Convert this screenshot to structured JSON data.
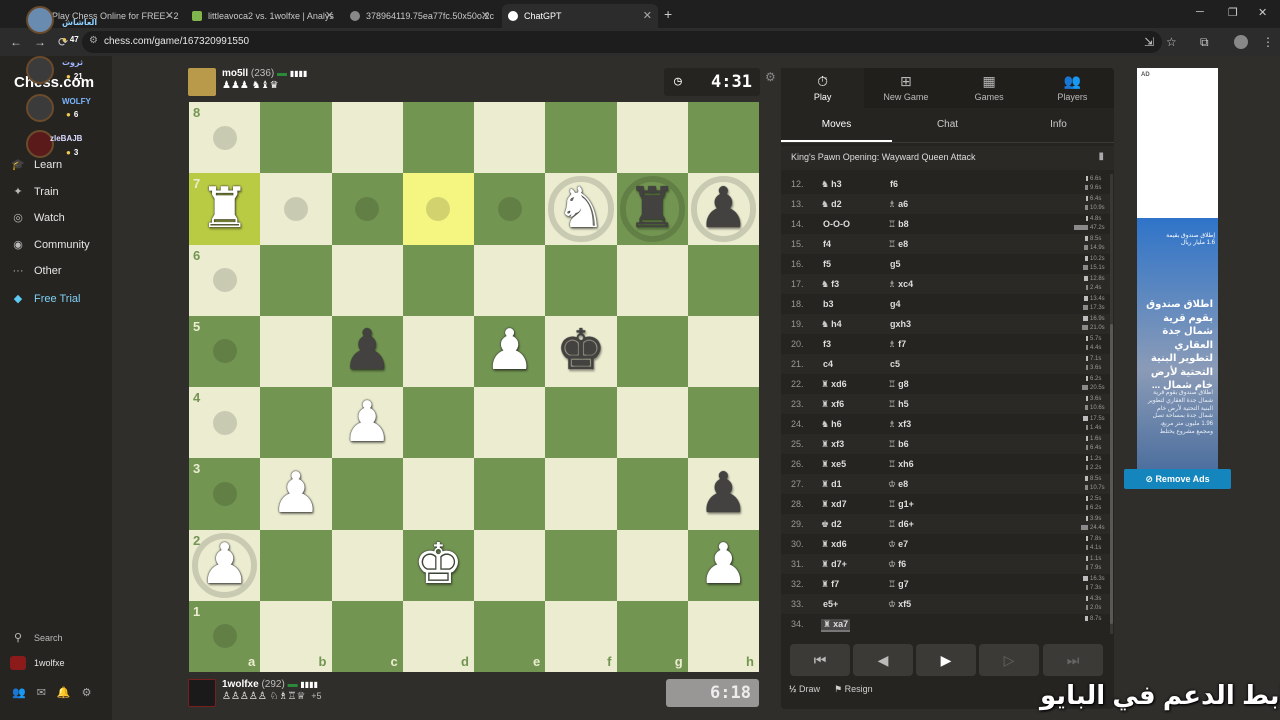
{
  "browser": {
    "tabs": [
      {
        "title": "Play Chess Online for FREE - 2 P",
        "active": false
      },
      {
        "title": "littleavoca2 vs. 1wolfxe | Analys",
        "active": false
      },
      {
        "title": "378964119.75ea77fc.50x50o.2c",
        "active": false
      },
      {
        "title": "ChatGPT",
        "active": true
      }
    ],
    "url": "chess.com/game/167320991550"
  },
  "overlay_users": [
    {
      "name": "العاشاش",
      "coins": "47"
    },
    {
      "name": "ثروت",
      "coins": "21"
    },
    {
      "name": "WOLFY",
      "coins": "6"
    },
    {
      "name": "zleBAJB",
      "coins": "3"
    }
  ],
  "sidebar": {
    "logo": "Chess.com",
    "items": [
      {
        "label": "Learn",
        "icon": "graduation-icon"
      },
      {
        "label": "Train",
        "icon": "target-icon"
      },
      {
        "label": "Watch",
        "icon": "binoculars-icon"
      },
      {
        "label": "Community",
        "icon": "community-icon"
      },
      {
        "label": "Other",
        "icon": "more-icon"
      },
      {
        "label": "Free Trial",
        "icon": "diamond-icon"
      }
    ],
    "search": "Search",
    "user": "1wolfxe"
  },
  "top_player": {
    "name": "mo5ll",
    "rating": "(236)",
    "captured": "♟♟♟ ♞♝♛"
  },
  "bottom_player": {
    "name": "1wolfxe",
    "rating": "(292)",
    "captured": "♙♙♙♙♙ ♘♗♖♕",
    "advantage": "+5"
  },
  "clocks": {
    "top": "4:31",
    "bottom": "6:18"
  },
  "board": {
    "ranks": [
      "8",
      "7",
      "6",
      "5",
      "4",
      "3",
      "2",
      "1"
    ],
    "files": [
      "a",
      "b",
      "c",
      "d",
      "e",
      "f",
      "g",
      "h"
    ],
    "pieces": [
      {
        "sq": "a7",
        "glyph": "♜",
        "color": "w"
      },
      {
        "sq": "f7",
        "glyph": "♞",
        "color": "w"
      },
      {
        "sq": "g7",
        "glyph": "♜",
        "color": "b"
      },
      {
        "sq": "h7",
        "glyph": "♟",
        "color": "b"
      },
      {
        "sq": "c5",
        "glyph": "♟",
        "color": "b"
      },
      {
        "sq": "e5",
        "glyph": "♟",
        "color": "w"
      },
      {
        "sq": "f5",
        "glyph": "♚",
        "color": "b"
      },
      {
        "sq": "c4",
        "glyph": "♟",
        "color": "w"
      },
      {
        "sq": "b3",
        "glyph": "♟",
        "color": "w"
      },
      {
        "sq": "h3",
        "glyph": "♟",
        "color": "b"
      },
      {
        "sq": "a2",
        "glyph": "♟",
        "color": "w"
      },
      {
        "sq": "d2",
        "glyph": "♚",
        "color": "w"
      },
      {
        "sq": "h2",
        "glyph": "♟",
        "color": "w"
      }
    ],
    "highlight": [
      "a7",
      "d7"
    ],
    "dots": [
      "a8",
      "b7",
      "c7",
      "d7",
      "e7",
      "a6",
      "a5",
      "a4",
      "a3",
      "a1"
    ],
    "rings": [
      "f7",
      "g7",
      "h7",
      "a2"
    ]
  },
  "panel": {
    "tabs": [
      {
        "label": "Play",
        "icon": "stopwatch-icon"
      },
      {
        "label": "New Game",
        "icon": "plus-icon"
      },
      {
        "label": "Games",
        "icon": "board-icon"
      },
      {
        "label": "Players",
        "icon": "players-icon"
      }
    ],
    "subtabs": [
      "Moves",
      "Chat",
      "Info"
    ],
    "opening": "King's Pawn Opening: Wayward Queen Attack",
    "moves": [
      {
        "n": "12.",
        "w": "h3",
        "wf": "♞",
        "b": "f6",
        "bf": "",
        "t": [
          "6.6s",
          "9.6s"
        ]
      },
      {
        "n": "13.",
        "w": "d2",
        "wf": "♞",
        "b": "a6",
        "bf": "♗",
        "t": [
          "6.4s",
          "10.9s"
        ]
      },
      {
        "n": "14.",
        "w": "O-O-O",
        "wf": "",
        "b": "b8",
        "bf": "♖",
        "t": [
          "4.8s",
          "47.2s"
        ]
      },
      {
        "n": "15.",
        "w": "f4",
        "wf": "",
        "b": "e8",
        "bf": "♖",
        "t": [
          "8.5s",
          "14.9s"
        ]
      },
      {
        "n": "16.",
        "w": "f5",
        "wf": "",
        "b": "g5",
        "bf": "",
        "t": [
          "10.2s",
          "15.1s"
        ]
      },
      {
        "n": "17.",
        "w": "f3",
        "wf": "♞",
        "b": "xc4",
        "bf": "♗",
        "t": [
          "12.8s",
          "2.4s"
        ]
      },
      {
        "n": "18.",
        "w": "b3",
        "wf": "",
        "b": "g4",
        "bf": "",
        "t": [
          "13.4s",
          "17.3s"
        ]
      },
      {
        "n": "19.",
        "w": "h4",
        "wf": "♞",
        "b": "gxh3",
        "bf": "",
        "t": [
          "16.9s",
          "21.0s"
        ]
      },
      {
        "n": "20.",
        "w": "f3",
        "wf": "",
        "b": "f7",
        "bf": "♗",
        "t": [
          "5.7s",
          "4.4s"
        ]
      },
      {
        "n": "21.",
        "w": "c4",
        "wf": "",
        "b": "c5",
        "bf": "",
        "t": [
          "7.1s",
          "3.6s"
        ]
      },
      {
        "n": "22.",
        "w": "xd6",
        "wf": "♜",
        "b": "g8",
        "bf": "♖",
        "t": [
          "6.2s",
          "20.5s"
        ]
      },
      {
        "n": "23.",
        "w": "xf6",
        "wf": "♜",
        "b": "h5",
        "bf": "♖",
        "t": [
          "3.6s",
          "10.6s"
        ]
      },
      {
        "n": "24.",
        "w": "h6",
        "wf": "♞",
        "b": "xf3",
        "bf": "♗",
        "t": [
          "17.5s",
          "1.4s"
        ]
      },
      {
        "n": "25.",
        "w": "xf3",
        "wf": "♜",
        "b": "b6",
        "bf": "♖",
        "t": [
          "1.6s",
          "6.4s"
        ]
      },
      {
        "n": "26.",
        "w": "xe5",
        "wf": "♜",
        "b": "xh6",
        "bf": "♖",
        "t": [
          "1.2s",
          "2.2s"
        ]
      },
      {
        "n": "27.",
        "w": "d1",
        "wf": "♜",
        "b": "e8",
        "bf": "♔",
        "t": [
          "8.5s",
          "10.7s"
        ]
      },
      {
        "n": "28.",
        "w": "xd7",
        "wf": "♜",
        "b": "g1+",
        "bf": "♖",
        "t": [
          "2.5s",
          "6.2s"
        ]
      },
      {
        "n": "29.",
        "w": "d2",
        "wf": "♚",
        "b": "d6+",
        "bf": "♖",
        "t": [
          "3.9s",
          "24.4s"
        ]
      },
      {
        "n": "30.",
        "w": "xd6",
        "wf": "♜",
        "b": "e7",
        "bf": "♔",
        "t": [
          "7.8s",
          "4.1s"
        ]
      },
      {
        "n": "31.",
        "w": "d7+",
        "wf": "♜",
        "b": "f6",
        "bf": "♔",
        "t": [
          "1.1s",
          "7.9s"
        ]
      },
      {
        "n": "32.",
        "w": "f7",
        "wf": "♜",
        "b": "g7",
        "bf": "♖",
        "t": [
          "16.3s",
          "7.3s"
        ]
      },
      {
        "n": "33.",
        "w": "e5+",
        "wf": "",
        "b": "xf5",
        "bf": "♔",
        "t": [
          "4.3s",
          "2.0s"
        ]
      },
      {
        "n": "34.",
        "w": "xa7",
        "wf": "♜",
        "b": "",
        "bf": "",
        "t": [
          "8.7s"
        ]
      }
    ],
    "actions": {
      "draw": "Draw",
      "resign": "Resign"
    }
  },
  "ad": {
    "tag": "AD",
    "small": "إطلاق صندوق بقيمة 1.6 مليار ريال",
    "headline": "اطلاق صندوق بقوم قرية شمال جدة العقاري لتطوير البنية التحتية لأرض خام شمال ...",
    "body": "اطلاق صندوق بقوم قرية شمال جدة العقاري لتطوير البنية التحتية لأرض خام شمال جدة بمساحة تصل 1.96 مليون متر مربع، ومجمع مشروع يختلط",
    "remove": "Remove Ads"
  },
  "caption": "رابط الدعم في البايو"
}
